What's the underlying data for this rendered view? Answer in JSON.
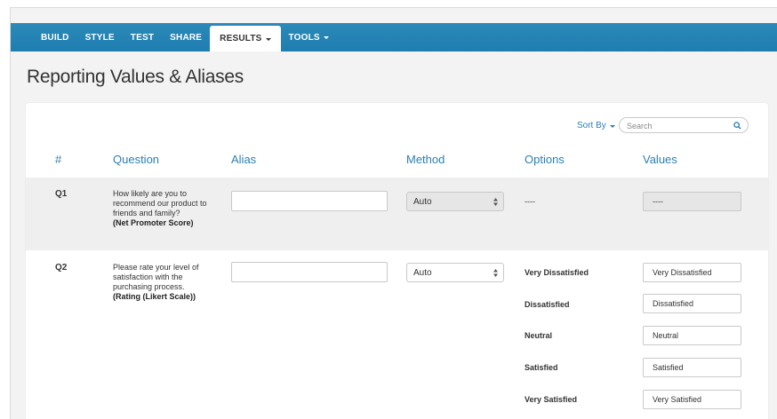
{
  "nav": {
    "items": [
      {
        "label": "BUILD"
      },
      {
        "label": "STYLE"
      },
      {
        "label": "TEST"
      },
      {
        "label": "SHARE"
      },
      {
        "label": "RESULTS"
      },
      {
        "label": "TOOLS"
      }
    ],
    "active_item": "RESULTS"
  },
  "page_title": "Reporting Values & Aliases",
  "toolbar": {
    "sort_label": "Sort By",
    "search_placeholder": "Search"
  },
  "table": {
    "headers": [
      "#",
      "Question",
      "Alias",
      "Method",
      "Options",
      "Values"
    ],
    "rows": [
      {
        "number": "Q1",
        "question": "How likely are you to recommend our product to friends and family?",
        "question_type": "(Net Promoter Score)",
        "alias": "",
        "method": "Auto",
        "method_disabled": true,
        "options": [
          {
            "label": "----",
            "value": "----",
            "disabled": true
          }
        ]
      },
      {
        "number": "Q2",
        "question": "Please rate your level of satisfaction with the purchasing process.",
        "question_type": "(Rating (Likert Scale))",
        "alias": "",
        "method": "Auto",
        "method_disabled": false,
        "options": [
          {
            "label": "Very Dissatisfied",
            "value": "Very Dissatisfied"
          },
          {
            "label": "Dissatisfied",
            "value": "Dissatisfied"
          },
          {
            "label": "Neutral",
            "value": "Neutral"
          },
          {
            "label": "Satisfied",
            "value": "Satisfied"
          },
          {
            "label": "Very Satisfied",
            "value": "Very Satisfied"
          }
        ]
      }
    ]
  },
  "colors": {
    "nav_bar": "#1f7db0",
    "accent_link": "#2b7fb5",
    "row_highlight": "#efefef"
  },
  "icons": {
    "search": "search-icon",
    "dropdown": "chevron-down-icon",
    "select_arrows": "select-updown-icon"
  }
}
